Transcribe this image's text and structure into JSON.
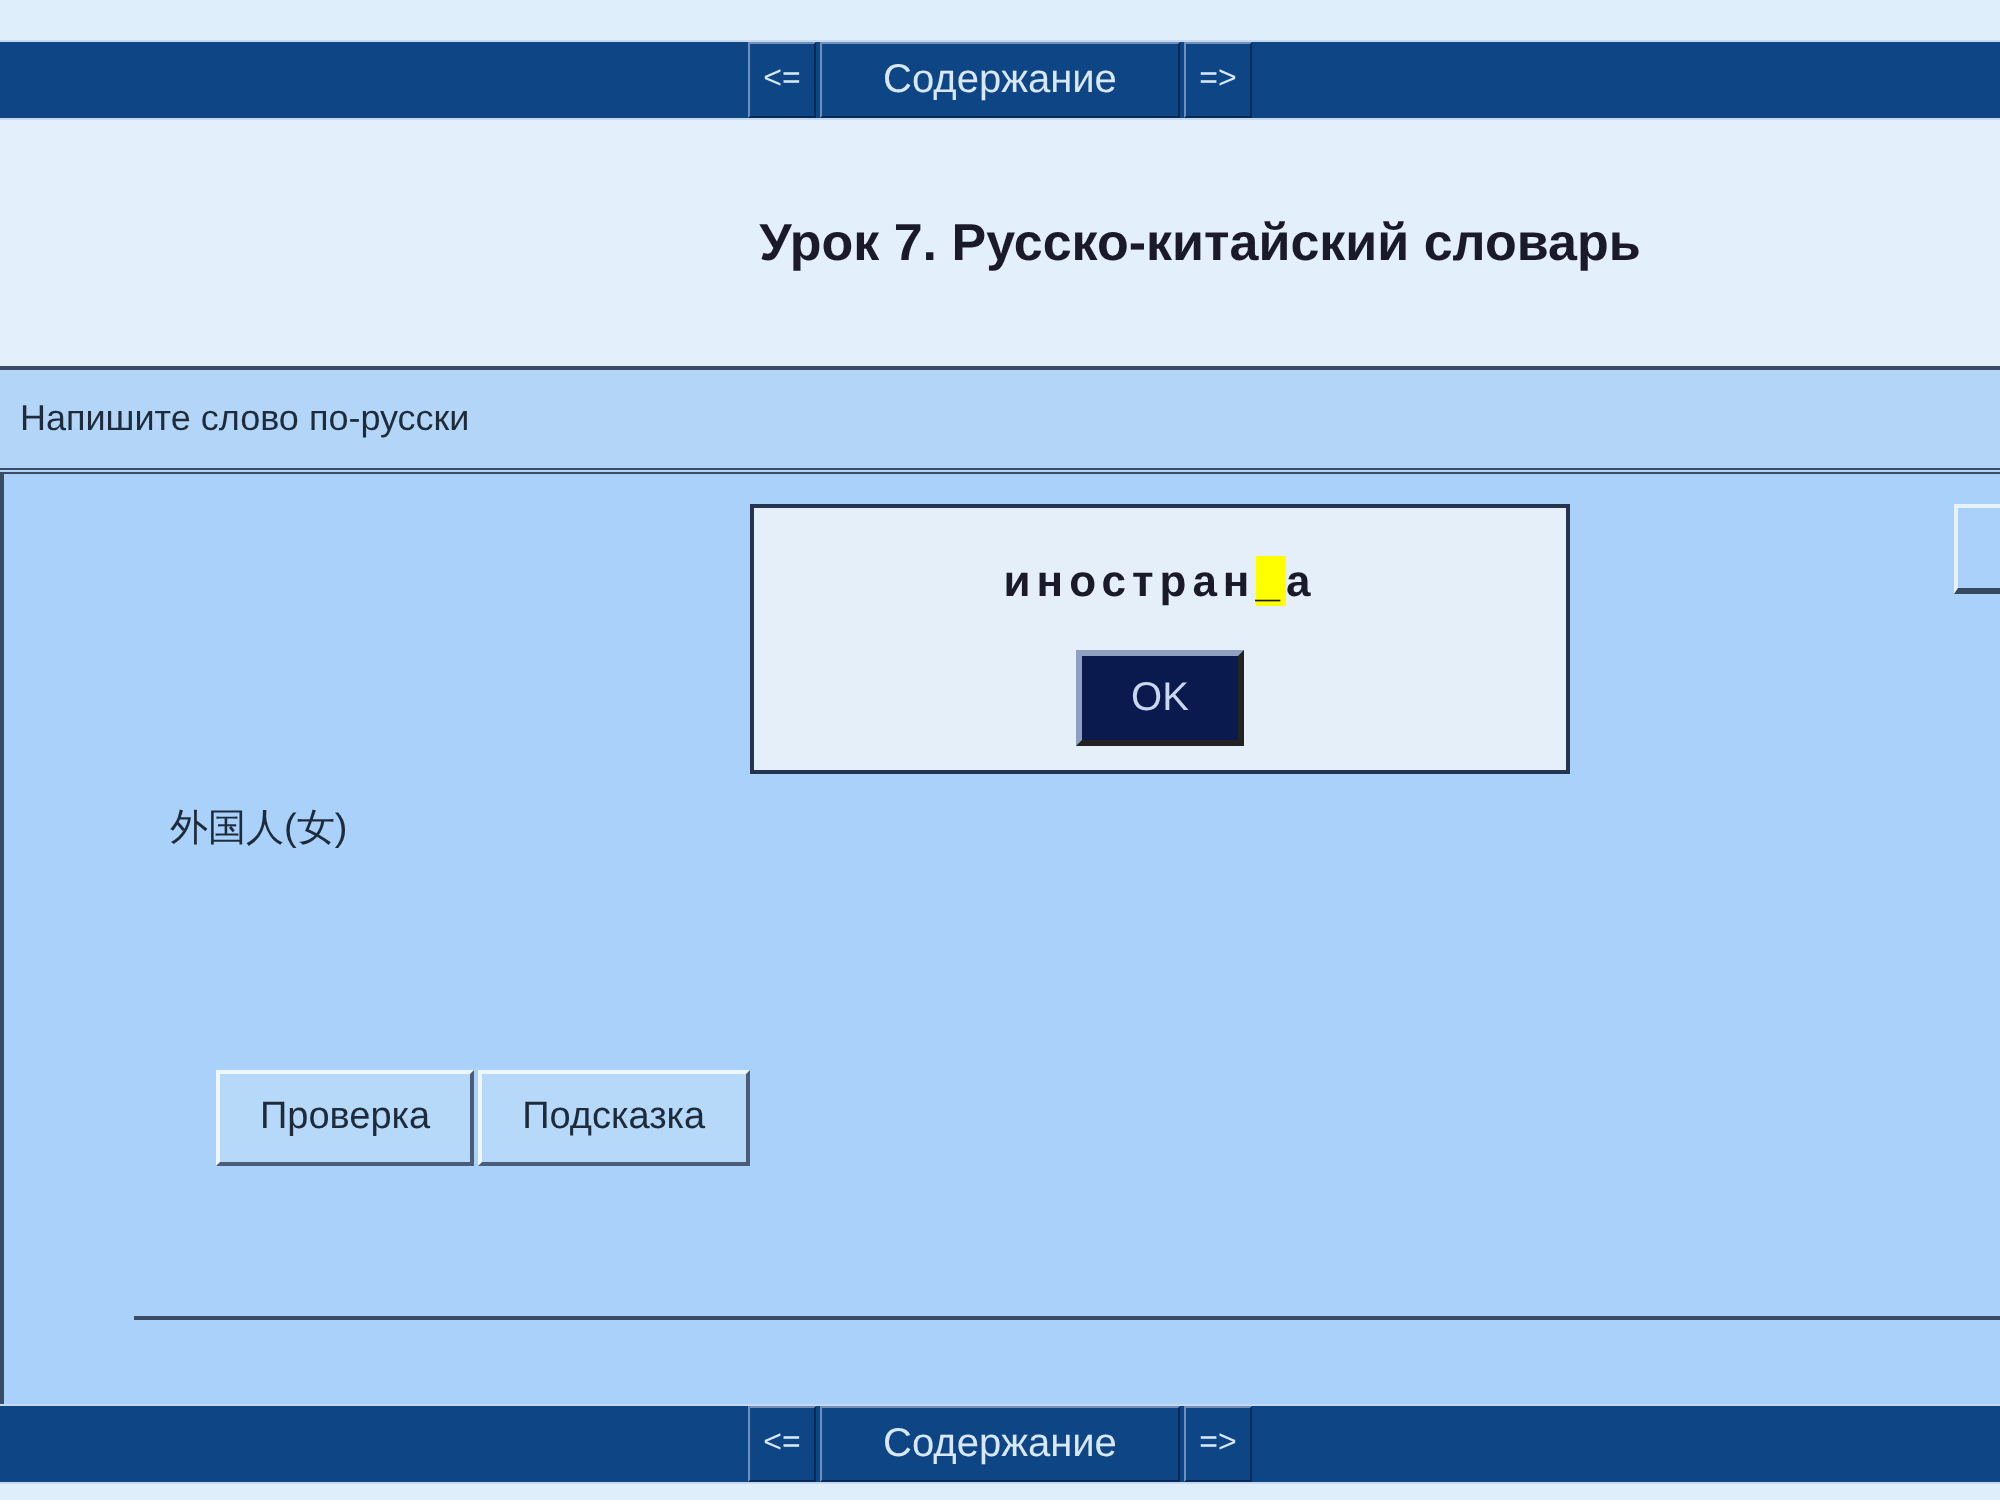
{
  "nav_top": {
    "prev": "<=",
    "contents": "Содержание",
    "next": "=>"
  },
  "title": "Урок 7. Русско-китайский словарь",
  "instruction": "Напишите слово по-русски",
  "prompt_word": "外国人(女)",
  "dialog": {
    "word_before": "иностран",
    "blank": "_",
    "word_after": "а",
    "ok": "OK"
  },
  "buttons": [
    "Проверка",
    "Подсказка"
  ],
  "nav_bottom": {
    "prev": "<=",
    "contents": "Содержание",
    "next": "=>"
  }
}
